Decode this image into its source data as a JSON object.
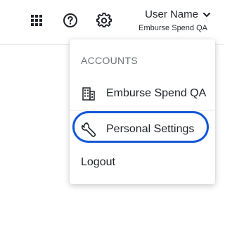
{
  "header": {
    "icons": {
      "apps": "grid-icon",
      "help": "help-circle-icon",
      "settings": "gear-icon"
    },
    "user": {
      "name": "User Name",
      "org": "Emburse Spend QA",
      "chevron": "chevron-down-icon"
    }
  },
  "menu": {
    "section_label": "ACCOUNTS",
    "items": [
      {
        "label": "Emburse Spend QA",
        "icon": "building-icon"
      },
      {
        "label": "Personal Settings",
        "icon": "wrench-icon"
      },
      {
        "label": "Logout"
      }
    ]
  },
  "colors": {
    "highlight_ring": "#1457d6",
    "text": "#1f2329",
    "muted": "#6f747a"
  }
}
